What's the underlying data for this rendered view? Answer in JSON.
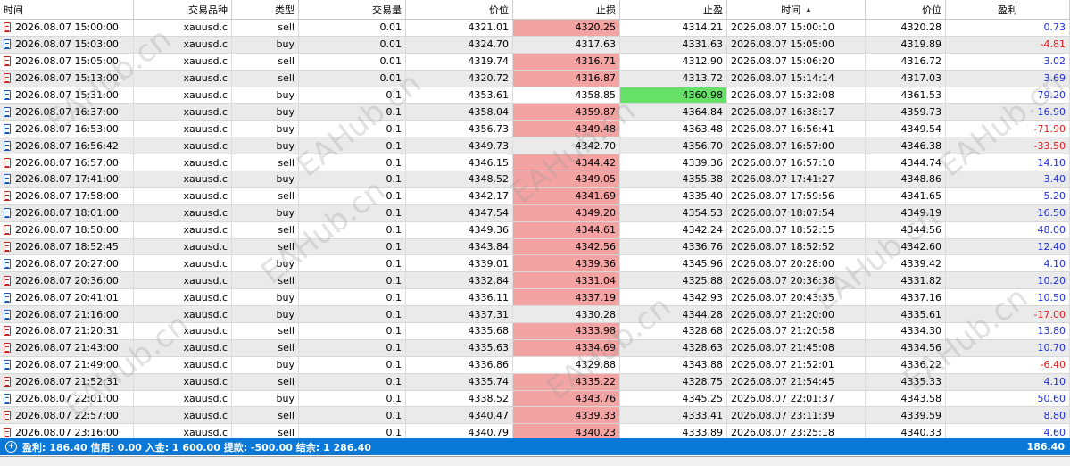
{
  "columns": [
    "时间",
    "交易品种",
    "类型",
    "交易量",
    "价位",
    "止损",
    "止盈",
    "时间",
    "价位",
    "盈利"
  ],
  "sorted_column_icon": "sort-ascending-icon",
  "trades": [
    {
      "open_time": "2026.08.07 15:00:00",
      "symbol": "xauusd.c",
      "type": "sell",
      "volume": "0.01",
      "open_price": "4321.01",
      "sl": "4320.25",
      "tp": "4314.21",
      "close_time": "2026.08.07 15:00:10",
      "close_price": "4320.28",
      "profit": "0.73",
      "sl_hit": true,
      "tp_hit": false
    },
    {
      "open_time": "2026.08.07 15:03:00",
      "symbol": "xauusd.c",
      "type": "buy",
      "volume": "0.01",
      "open_price": "4324.70",
      "sl": "4317.63",
      "tp": "4331.63",
      "close_time": "2026.08.07 15:05:00",
      "close_price": "4319.89",
      "profit": "-4.81",
      "sl_hit": false,
      "tp_hit": false
    },
    {
      "open_time": "2026.08.07 15:05:00",
      "symbol": "xauusd.c",
      "type": "sell",
      "volume": "0.01",
      "open_price": "4319.74",
      "sl": "4316.71",
      "tp": "4312.90",
      "close_time": "2026.08.07 15:06:20",
      "close_price": "4316.72",
      "profit": "3.02",
      "sl_hit": true,
      "tp_hit": false
    },
    {
      "open_time": "2026.08.07 15:13:00",
      "symbol": "xauusd.c",
      "type": "sell",
      "volume": "0.01",
      "open_price": "4320.72",
      "sl": "4316.87",
      "tp": "4313.72",
      "close_time": "2026.08.07 15:14:14",
      "close_price": "4317.03",
      "profit": "3.69",
      "sl_hit": true,
      "tp_hit": false
    },
    {
      "open_time": "2026.08.07 15:31:00",
      "symbol": "xauusd.c",
      "type": "buy",
      "volume": "0.1",
      "open_price": "4353.61",
      "sl": "4358.85",
      "tp": "4360.98",
      "close_time": "2026.08.07 15:32:08",
      "close_price": "4361.53",
      "profit": "79.20",
      "sl_hit": false,
      "tp_hit": true
    },
    {
      "open_time": "2026.08.07 16:37:00",
      "symbol": "xauusd.c",
      "type": "buy",
      "volume": "0.1",
      "open_price": "4358.04",
      "sl": "4359.87",
      "tp": "4364.84",
      "close_time": "2026.08.07 16:38:17",
      "close_price": "4359.73",
      "profit": "16.90",
      "sl_hit": true,
      "tp_hit": false
    },
    {
      "open_time": "2026.08.07 16:53:00",
      "symbol": "xauusd.c",
      "type": "buy",
      "volume": "0.1",
      "open_price": "4356.73",
      "sl": "4349.48",
      "tp": "4363.48",
      "close_time": "2026.08.07 16:56:41",
      "close_price": "4349.54",
      "profit": "-71.90",
      "sl_hit": true,
      "tp_hit": false
    },
    {
      "open_time": "2026.08.07 16:56:42",
      "symbol": "xauusd.c",
      "type": "buy",
      "volume": "0.1",
      "open_price": "4349.73",
      "sl": "4342.70",
      "tp": "4356.70",
      "close_time": "2026.08.07 16:57:00",
      "close_price": "4346.38",
      "profit": "-33.50",
      "sl_hit": false,
      "tp_hit": false
    },
    {
      "open_time": "2026.08.07 16:57:00",
      "symbol": "xauusd.c",
      "type": "sell",
      "volume": "0.1",
      "open_price": "4346.15",
      "sl": "4344.42",
      "tp": "4339.36",
      "close_time": "2026.08.07 16:57:10",
      "close_price": "4344.74",
      "profit": "14.10",
      "sl_hit": true,
      "tp_hit": false
    },
    {
      "open_time": "2026.08.07 17:41:00",
      "symbol": "xauusd.c",
      "type": "buy",
      "volume": "0.1",
      "open_price": "4348.52",
      "sl": "4349.05",
      "tp": "4355.38",
      "close_time": "2026.08.07 17:41:27",
      "close_price": "4348.86",
      "profit": "3.40",
      "sl_hit": true,
      "tp_hit": false
    },
    {
      "open_time": "2026.08.07 17:58:00",
      "symbol": "xauusd.c",
      "type": "sell",
      "volume": "0.1",
      "open_price": "4342.17",
      "sl": "4341.69",
      "tp": "4335.40",
      "close_time": "2026.08.07 17:59:56",
      "close_price": "4341.65",
      "profit": "5.20",
      "sl_hit": true,
      "tp_hit": false
    },
    {
      "open_time": "2026.08.07 18:01:00",
      "symbol": "xauusd.c",
      "type": "buy",
      "volume": "0.1",
      "open_price": "4347.54",
      "sl": "4349.20",
      "tp": "4354.53",
      "close_time": "2026.08.07 18:07:54",
      "close_price": "4349.19",
      "profit": "16.50",
      "sl_hit": true,
      "tp_hit": false
    },
    {
      "open_time": "2026.08.07 18:50:00",
      "symbol": "xauusd.c",
      "type": "sell",
      "volume": "0.1",
      "open_price": "4349.36",
      "sl": "4344.61",
      "tp": "4342.24",
      "close_time": "2026.08.07 18:52:15",
      "close_price": "4344.56",
      "profit": "48.00",
      "sl_hit": true,
      "tp_hit": false
    },
    {
      "open_time": "2026.08.07 18:52:45",
      "symbol": "xauusd.c",
      "type": "sell",
      "volume": "0.1",
      "open_price": "4343.84",
      "sl": "4342.56",
      "tp": "4336.76",
      "close_time": "2026.08.07 18:52:52",
      "close_price": "4342.60",
      "profit": "12.40",
      "sl_hit": true,
      "tp_hit": false
    },
    {
      "open_time": "2026.08.07 20:27:00",
      "symbol": "xauusd.c",
      "type": "buy",
      "volume": "0.1",
      "open_price": "4339.01",
      "sl": "4339.36",
      "tp": "4345.96",
      "close_time": "2026.08.07 20:28:00",
      "close_price": "4339.42",
      "profit": "4.10",
      "sl_hit": true,
      "tp_hit": false
    },
    {
      "open_time": "2026.08.07 20:36:00",
      "symbol": "xauusd.c",
      "type": "sell",
      "volume": "0.1",
      "open_price": "4332.84",
      "sl": "4331.04",
      "tp": "4325.88",
      "close_time": "2026.08.07 20:36:38",
      "close_price": "4331.82",
      "profit": "10.20",
      "sl_hit": true,
      "tp_hit": false
    },
    {
      "open_time": "2026.08.07 20:41:01",
      "symbol": "xauusd.c",
      "type": "buy",
      "volume": "0.1",
      "open_price": "4336.11",
      "sl": "4337.19",
      "tp": "4342.93",
      "close_time": "2026.08.07 20:43:35",
      "close_price": "4337.16",
      "profit": "10.50",
      "sl_hit": true,
      "tp_hit": false
    },
    {
      "open_time": "2026.08.07 21:16:00",
      "symbol": "xauusd.c",
      "type": "buy",
      "volume": "0.1",
      "open_price": "4337.31",
      "sl": "4330.28",
      "tp": "4344.28",
      "close_time": "2026.08.07 21:20:00",
      "close_price": "4335.61",
      "profit": "-17.00",
      "sl_hit": false,
      "tp_hit": false
    },
    {
      "open_time": "2026.08.07 21:20:31",
      "symbol": "xauusd.c",
      "type": "sell",
      "volume": "0.1",
      "open_price": "4335.68",
      "sl": "4333.98",
      "tp": "4328.68",
      "close_time": "2026.08.07 21:20:58",
      "close_price": "4334.30",
      "profit": "13.80",
      "sl_hit": true,
      "tp_hit": false
    },
    {
      "open_time": "2026.08.07 21:43:00",
      "symbol": "xauusd.c",
      "type": "sell",
      "volume": "0.1",
      "open_price": "4335.63",
      "sl": "4334.69",
      "tp": "4328.63",
      "close_time": "2026.08.07 21:45:08",
      "close_price": "4334.56",
      "profit": "10.70",
      "sl_hit": true,
      "tp_hit": false
    },
    {
      "open_time": "2026.08.07 21:49:00",
      "symbol": "xauusd.c",
      "type": "buy",
      "volume": "0.1",
      "open_price": "4336.86",
      "sl": "4329.88",
      "tp": "4343.88",
      "close_time": "2026.08.07 21:52:01",
      "close_price": "4336.22",
      "profit": "-6.40",
      "sl_hit": false,
      "tp_hit": false
    },
    {
      "open_time": "2026.08.07 21:52:31",
      "symbol": "xauusd.c",
      "type": "sell",
      "volume": "0.1",
      "open_price": "4335.74",
      "sl": "4335.22",
      "tp": "4328.75",
      "close_time": "2026.08.07 21:54:45",
      "close_price": "4335.33",
      "profit": "4.10",
      "sl_hit": true,
      "tp_hit": false
    },
    {
      "open_time": "2026.08.07 22:01:00",
      "symbol": "xauusd.c",
      "type": "buy",
      "volume": "0.1",
      "open_price": "4338.52",
      "sl": "4343.76",
      "tp": "4345.25",
      "close_time": "2026.08.07 22:01:37",
      "close_price": "4343.58",
      "profit": "50.60",
      "sl_hit": true,
      "tp_hit": false
    },
    {
      "open_time": "2026.08.07 22:57:00",
      "symbol": "xauusd.c",
      "type": "sell",
      "volume": "0.1",
      "open_price": "4340.47",
      "sl": "4339.33",
      "tp": "4333.41",
      "close_time": "2026.08.07 23:11:39",
      "close_price": "4339.59",
      "profit": "8.80",
      "sl_hit": true,
      "tp_hit": false
    },
    {
      "open_time": "2026.08.07 23:16:00",
      "symbol": "xauusd.c",
      "type": "sell",
      "volume": "0.1",
      "open_price": "4340.79",
      "sl": "4340.23",
      "tp": "4333.89",
      "close_time": "2026.08.07 23:25:18",
      "close_price": "4340.33",
      "profit": "4.60",
      "sl_hit": true,
      "tp_hit": false
    }
  ],
  "summary": {
    "text": "盈利: 186.40  信用: 0.00  入金: 1 600.00  提款: -500.00  结余: 1 286.40",
    "total": "186.40",
    "icon": "expand-plus-icon"
  },
  "colors": {
    "sl_hit_bg": "#f4a3a3",
    "tp_hit_bg": "#66e066",
    "profit_positive": "#1e2fd6",
    "profit_negative": "#e21b1b",
    "summary_bar": "#0a78d6"
  },
  "watermark": "EAHub.cn"
}
